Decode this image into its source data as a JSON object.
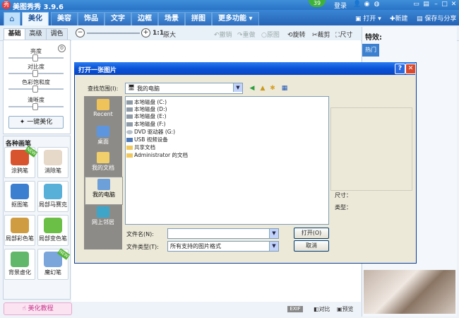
{
  "app": {
    "title": "美图秀秀 3.9.6",
    "logo_char": "秀",
    "badge": "39"
  },
  "top_links": {
    "login": "登录"
  },
  "menu": {
    "home_icon": "home-icon",
    "tabs": [
      "美化",
      "美容",
      "饰品",
      "文字",
      "边框",
      "场景",
      "拼图",
      "更多功能 ▾"
    ],
    "open": "打开",
    "new": "新建",
    "save_share": "保存与分享"
  },
  "toolbar": {
    "side_tabs": [
      "基础",
      "高级",
      "调色"
    ],
    "zoom_reset": "1:1",
    "original_size": "原大",
    "undo": "撤销",
    "redo": "重做",
    "original": "原图",
    "rotate": "旋转",
    "crop": "裁剪",
    "size": "尺寸"
  },
  "adjust": {
    "sliders": [
      "亮度",
      "对比度",
      "色彩饱和度",
      "清晰度"
    ],
    "one_key": "一键美化"
  },
  "brushes": {
    "title": "各种画笔",
    "items": [
      {
        "label": "涂鸦笔",
        "color": "#d8542f",
        "new": true
      },
      {
        "label": "消除笔",
        "color": "#e7d9c9",
        "new": false
      },
      {
        "label": "抠图笔",
        "color": "#3b7fd0",
        "new": false
      },
      {
        "label": "局部马赛克",
        "color": "#58b0d8",
        "new": false
      },
      {
        "label": "局部彩色笔",
        "color": "#cf9c41",
        "new": false
      },
      {
        "label": "局部变色笔",
        "color": "#6cbf46",
        "new": false
      },
      {
        "label": "背景虚化",
        "color": "#61b86a",
        "new": false
      },
      {
        "label": "魔幻笔",
        "color": "#7aa6dc",
        "new": true
      }
    ],
    "new_tag": "NEW",
    "tutorial": "美化教程"
  },
  "right_panel": {
    "title": "特效:",
    "hot_tab": "热门"
  },
  "status": {
    "exif": "EXIF",
    "compare": "对比",
    "preview": "预览"
  },
  "dialog": {
    "title": "打开一张图片",
    "help": "?",
    "close": "✕",
    "look_in_label": "查找范围(I):",
    "look_in_value": "我的电脑",
    "places": [
      "Recent",
      "桌面",
      "我的文档",
      "我的电脑",
      "网上邻居"
    ],
    "files": [
      {
        "name": "本地磁盘 (C:)",
        "type": "drive"
      },
      {
        "name": "本地磁盘 (D:)",
        "type": "drive"
      },
      {
        "name": "本地磁盘 (E:)",
        "type": "drive"
      },
      {
        "name": "本地磁盘 (F:)",
        "type": "drive"
      },
      {
        "name": "DVD 驱动器 (G:)",
        "type": "dvd"
      },
      {
        "name": "USB 视频设备",
        "type": "usb"
      },
      {
        "name": "共享文档",
        "type": "folder"
      },
      {
        "name": "Administrator 的文档",
        "type": "folder"
      }
    ],
    "size_label": "尺寸：",
    "type_label": "类型：",
    "filename_label": "文件名(N):",
    "filename_value": "",
    "filetype_label": "文件类型(T):",
    "filetype_value": "所有支持的图片格式",
    "open_button": "打开(O)",
    "cancel_button": "取消"
  },
  "colors": {
    "accent": "#2a73c5",
    "dialog_title": "#0a52d6",
    "dialog_bg": "#ece9d8"
  }
}
